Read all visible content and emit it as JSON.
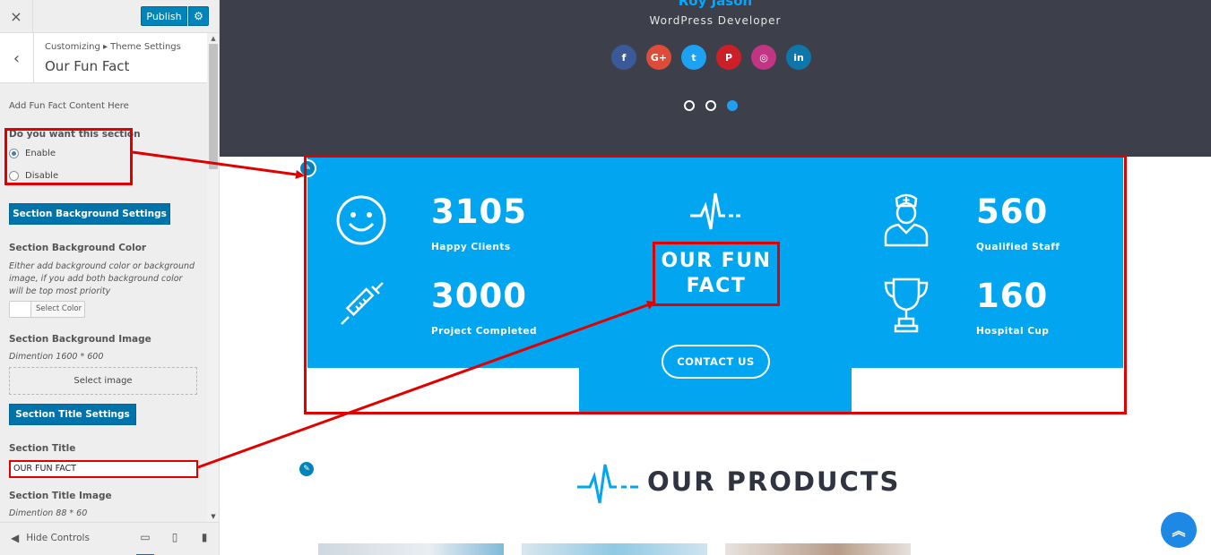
{
  "panel": {
    "close_icon": "×",
    "publish_label": "Publish",
    "breadcrumb": "Customizing ▸ Theme Settings",
    "title": "Our Fun Fact",
    "intro": "Add Fun Fact Content Here",
    "section_question": "Do you want this section",
    "radio_enable": "Enable",
    "radio_disable": "Disable",
    "enabled": true,
    "bg_settings_button": "Section Background Settings",
    "bg_color_label": "Section Background Color",
    "bg_color_desc": "Either add background color or background image, if you add both background color will be top most priority",
    "select_color": "Select Color",
    "bg_image_label": "Section Background Image",
    "bg_image_desc": "Dimention 1600 * 600",
    "select_image": "Select image",
    "title_settings_button": "Section Title Settings",
    "section_title_label": "Section Title",
    "section_title_value": "OUR FUN FACT",
    "title_image_label": "Section Title Image",
    "title_image_desc": "Dimention 88 * 60",
    "hide_controls": "Hide Controls"
  },
  "hero": {
    "name": "Roy Jason",
    "role": "WordPress Developer",
    "socials": [
      {
        "name": "facebook",
        "glyph": "f",
        "color": "#3b5998"
      },
      {
        "name": "google-plus",
        "glyph": "G+",
        "color": "#dd4b39"
      },
      {
        "name": "twitter",
        "glyph": "t",
        "color": "#1da1f2"
      },
      {
        "name": "pinterest",
        "glyph": "P",
        "color": "#cb2027"
      },
      {
        "name": "instagram",
        "glyph": "◎",
        "color": "#c13584"
      },
      {
        "name": "linkedin",
        "glyph": "in",
        "color": "#0e76a8"
      }
    ],
    "active_slide": 3
  },
  "funfact": {
    "title": "OUR FUN FACT",
    "contact_button": "CONTACT US",
    "stats": [
      {
        "value": "3105",
        "label": "Happy Clients",
        "icon": "smiley-icon"
      },
      {
        "value": "3000",
        "label": "Project Completed",
        "icon": "syringe-icon"
      },
      {
        "value": "560",
        "label": "Qualified Staff",
        "icon": "nurse-icon"
      },
      {
        "value": "160",
        "label": "Hospital Cup",
        "icon": "trophy-icon"
      }
    ]
  },
  "products": {
    "title": "OUR PRODUCTS"
  },
  "colors": {
    "accent": "#02a5ef",
    "hero_bg": "#3d3f4b",
    "annotation": "#e00000",
    "wp_blue": "#0073aa"
  }
}
